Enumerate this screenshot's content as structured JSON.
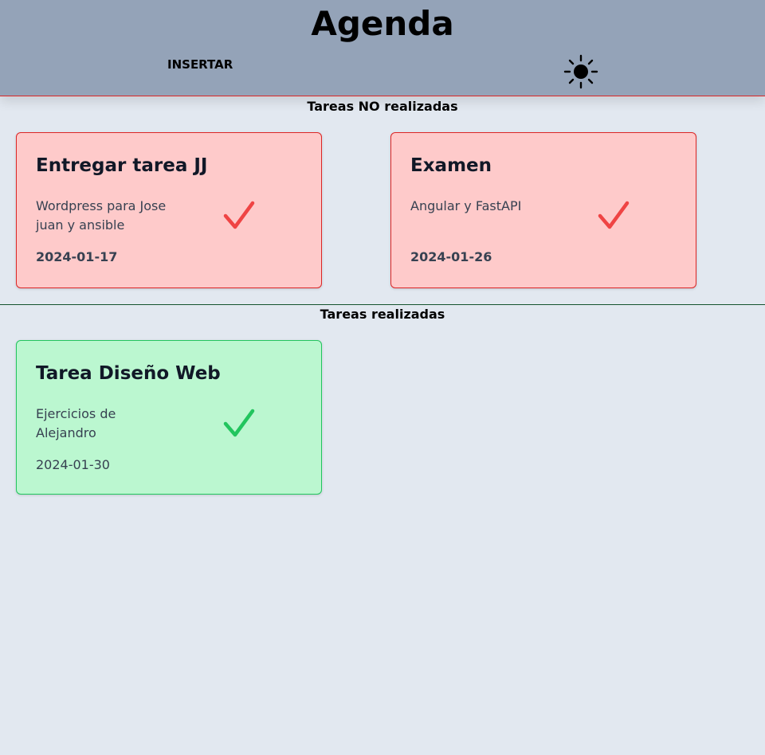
{
  "header": {
    "title": "Agenda",
    "insert_label": "INSERTAR",
    "theme_icon": "sun-icon"
  },
  "pending": {
    "title": "Tareas NO realizadas",
    "tasks": [
      {
        "title": "Entregar tarea JJ",
        "description": "Wordpress para Jose juan y ansible",
        "date": "2024-01-17"
      },
      {
        "title": "Examen",
        "description": "Angular y FastAPI",
        "date": "2024-01-26"
      }
    ]
  },
  "done": {
    "title": "Tareas realizadas",
    "tasks": [
      {
        "title": "Tarea Diseño Web",
        "description": "Ejercicios de Alejandro",
        "date": "2024-01-30"
      }
    ]
  },
  "colors": {
    "header_bg": "#94a3b8",
    "page_bg": "#e2e8f0",
    "pending_bg": "#fecaca",
    "pending_border": "#dc2626",
    "pending_check": "#ef4444",
    "done_bg": "#bbf7d0",
    "done_border": "#22c55e",
    "done_check": "#22c55e"
  }
}
